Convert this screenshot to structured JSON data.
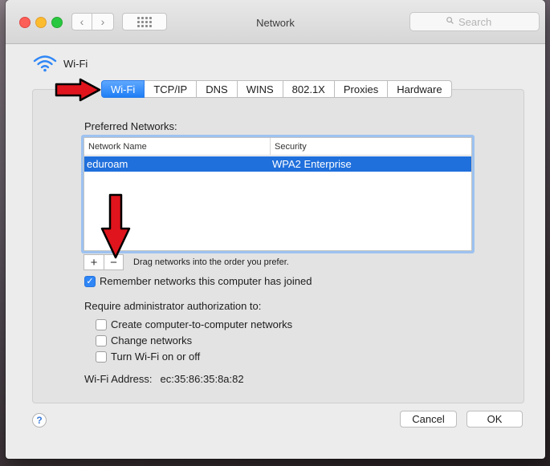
{
  "window": {
    "title": "Network"
  },
  "search": {
    "placeholder": "Search"
  },
  "header": {
    "title": "Wi-Fi"
  },
  "tabs": [
    {
      "label": "Wi-Fi",
      "active": true
    },
    {
      "label": "TCP/IP"
    },
    {
      "label": "DNS"
    },
    {
      "label": "WINS"
    },
    {
      "label": "802.1X"
    },
    {
      "label": "Proxies"
    },
    {
      "label": "Hardware"
    }
  ],
  "preferred": {
    "label": "Preferred Networks:",
    "columns": {
      "name": "Network Name",
      "security": "Security"
    },
    "rows": [
      {
        "name": "eduroam",
        "security": "WPA2 Enterprise",
        "selected": true
      }
    ],
    "add_label": "+",
    "remove_label": "−",
    "hint": "Drag networks into the order you prefer."
  },
  "options": {
    "remember": {
      "label": "Remember networks this computer has joined",
      "checked": true
    },
    "require_label": "Require administrator authorization to:",
    "items": [
      {
        "label": "Create computer-to-computer networks",
        "checked": false
      },
      {
        "label": "Change networks",
        "checked": false
      },
      {
        "label": "Turn Wi-Fi on or off",
        "checked": false
      }
    ]
  },
  "address": {
    "label": "Wi-Fi Address:",
    "value": "ec:35:86:35:8a:82"
  },
  "footer": {
    "help": "?",
    "cancel": "Cancel",
    "ok": "OK"
  },
  "colors": {
    "accent": "#1f7ef5",
    "selection": "#1f6fdc",
    "annotation": "#e0141c"
  }
}
